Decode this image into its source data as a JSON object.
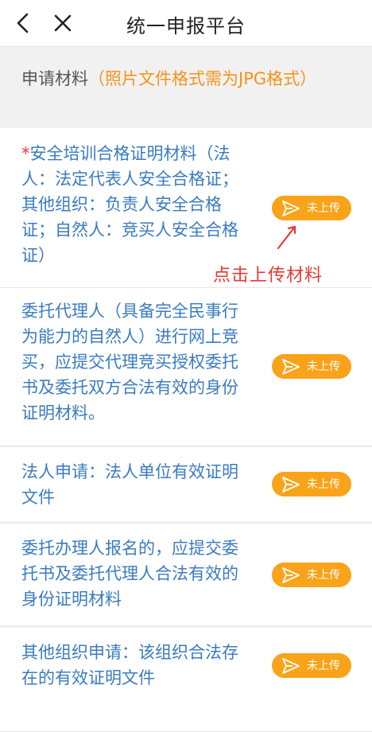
{
  "header": {
    "title": "统一申报平台",
    "back_icon": "chevron-left-icon",
    "close_icon": "close-icon"
  },
  "section": {
    "title": "申请材料",
    "hint": "（照片文件格式需为JPG格式）"
  },
  "materials": [
    {
      "required_mark": "*",
      "label": "安全培训合格证明材料（法人：法定代表人安全合格证；其他组织：负责人安全合格证；自然人：竞买人安全合格证）",
      "status": "未上传"
    },
    {
      "required_mark": "",
      "label": " 委托代理人（具备完全民事行为能力的自然人）进行网上竞买，应提交代理竞买授权委托书及委托双方合法有效的身份证明材料。",
      "status": "未上传"
    },
    {
      "required_mark": "",
      "label": " 法人申请：法人单位有效证明文件",
      "status": "未上传"
    },
    {
      "required_mark": "",
      "label": " 委托办理人报名的，应提交委托书及委托代理人合法有效的身份证明材料",
      "status": "未上传"
    },
    {
      "required_mark": "",
      "label": " 其他组织申请：该组织合法存在的有效证明文件",
      "status": "未上传"
    }
  ],
  "annotation": {
    "text": "点击上传材料"
  },
  "colors": {
    "accent_orange": "#f9a31a",
    "hint_orange": "#f39418",
    "label_blue": "#3a7bbf",
    "required_red": "#e53935"
  }
}
